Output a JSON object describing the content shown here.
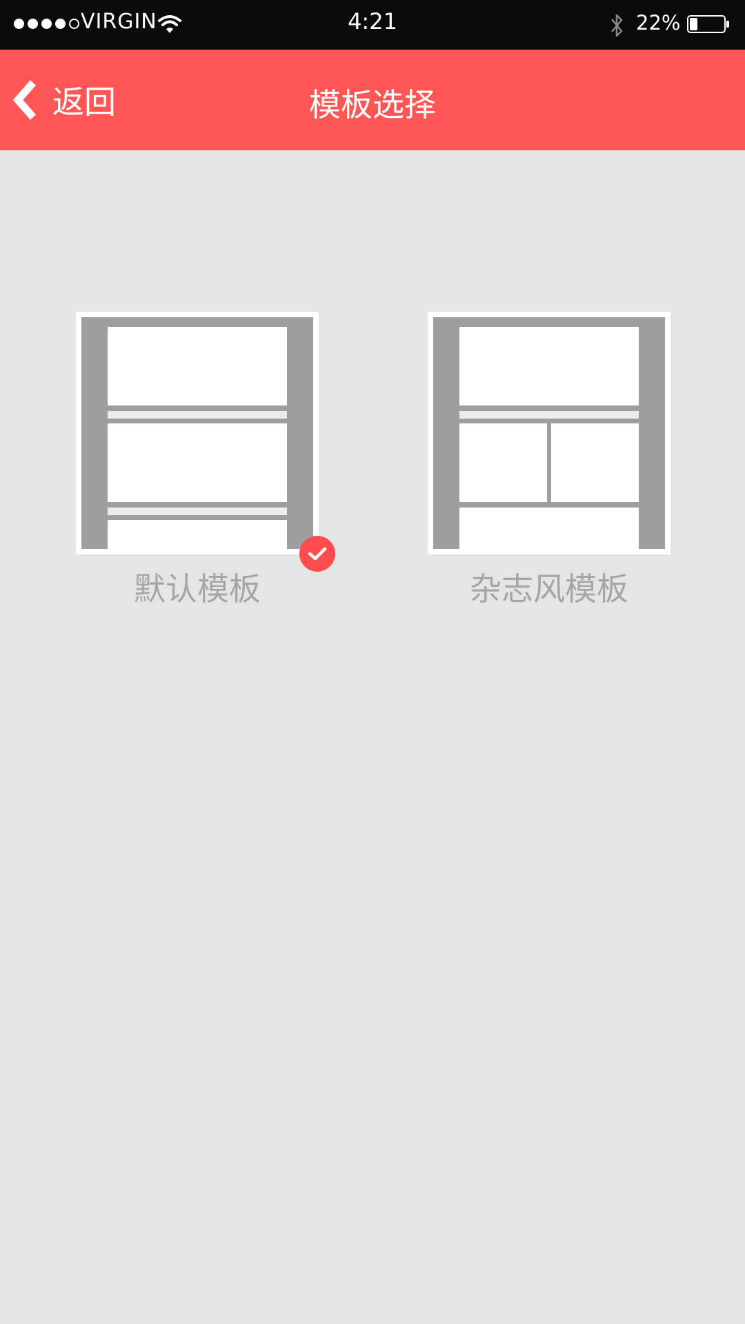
{
  "status_bar": {
    "carrier": "VIRGIN",
    "time": "4:21",
    "battery_percent": "22%",
    "battery_level": 0.22,
    "signal_bars": 4,
    "signal_total": 5
  },
  "nav": {
    "back_label": "返回",
    "title": "模板选择"
  },
  "templates": [
    {
      "label": "默认模板",
      "selected": true
    },
    {
      "label": "杂志风模板",
      "selected": false
    }
  ],
  "colors": {
    "accent": "#ff5555",
    "background": "#e5e5e5",
    "status_bar": "#0b0b0b"
  }
}
